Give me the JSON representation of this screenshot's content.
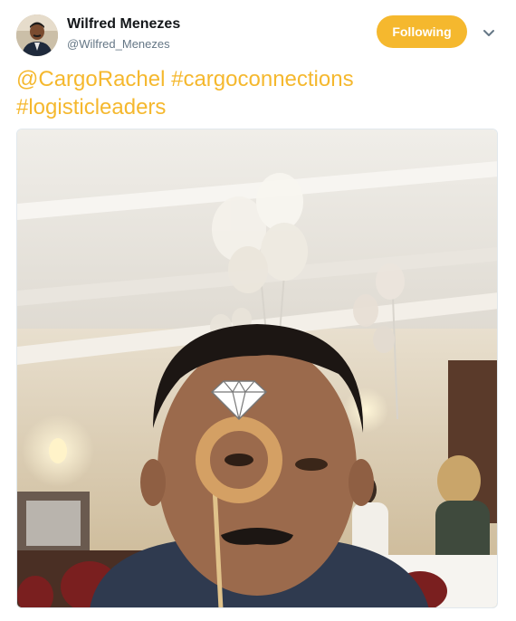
{
  "user": {
    "name": "Wilfred Menezes",
    "handle": "@Wilfred_Menezes"
  },
  "follow_button": {
    "label": "Following"
  },
  "tweet": {
    "mention": "@CargoRachel",
    "hashtag_1": "#cargoconnections",
    "hashtag_2": "#logisticleaders"
  },
  "colors": {
    "accent": "#f5b82e",
    "name_text": "#14171a",
    "handle_text": "#657786"
  },
  "icons": {
    "caret": "chevron-down-icon"
  }
}
